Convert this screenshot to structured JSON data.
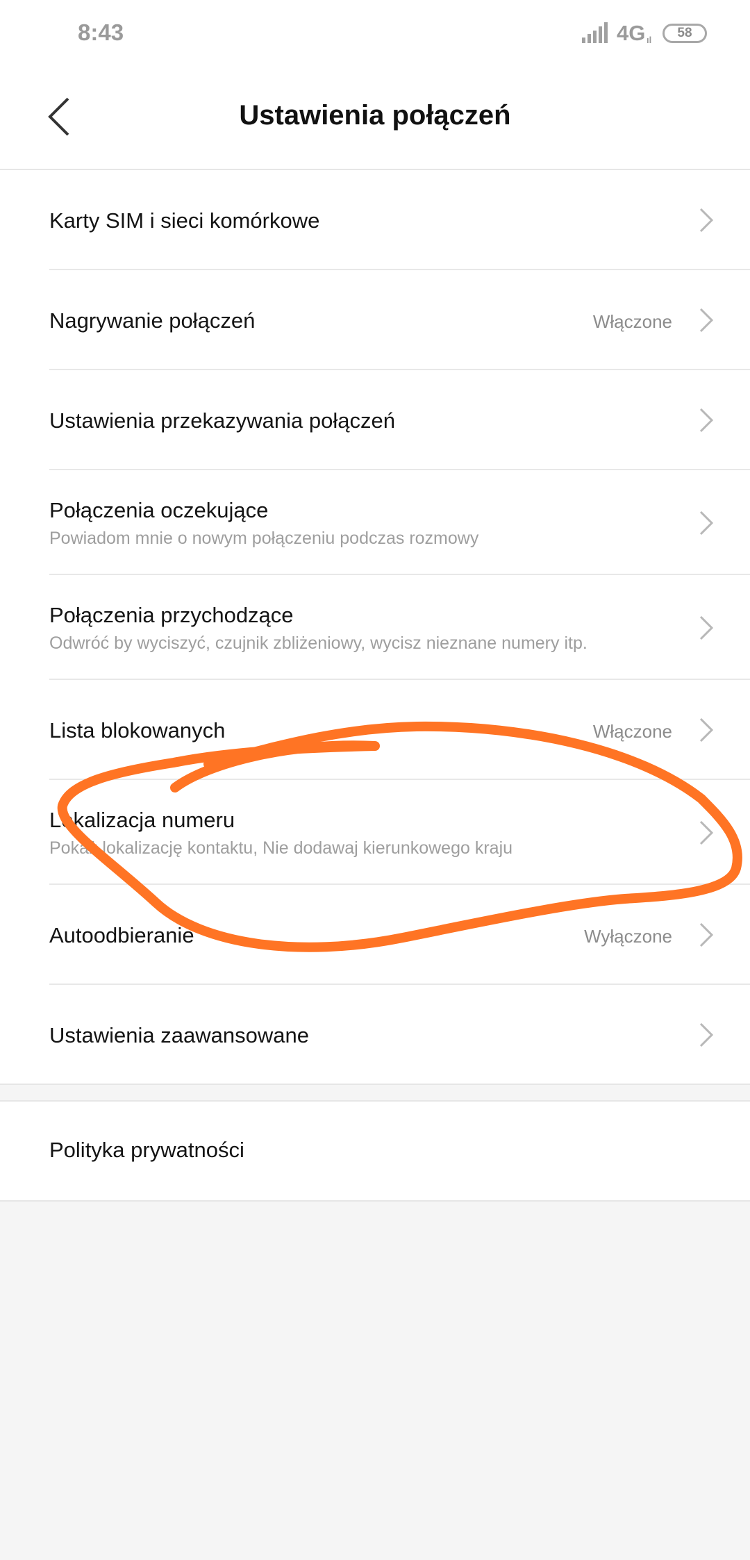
{
  "status_bar": {
    "time": "8:43",
    "network": "4G",
    "network_small": "ıl",
    "battery": "58"
  },
  "header": {
    "title": "Ustawienia połączeń",
    "back_icon": "chevron-left-icon"
  },
  "settings": [
    {
      "title": "Karty SIM i sieci komórkowe",
      "subtitle": "",
      "value": ""
    },
    {
      "title": "Nagrywanie połączeń",
      "subtitle": "",
      "value": "Włączone"
    },
    {
      "title": "Ustawienia przekazywania połączeń",
      "subtitle": "",
      "value": ""
    },
    {
      "title": "Połączenia oczekujące",
      "subtitle": "Powiadom mnie o nowym połączeniu podczas rozmowy",
      "value": ""
    },
    {
      "title": "Połączenia przychodzące",
      "subtitle": "Odwróć by wyciszyć, czujnik zbliżeniowy, wycisz nieznane numery itp.",
      "value": ""
    },
    {
      "title": "Lista blokowanych",
      "subtitle": "",
      "value": "Włączone"
    },
    {
      "title": "Lokalizacja numeru",
      "subtitle": "Pokaż lokalizację kontaktu, Nie dodawaj kierunkowego kraju",
      "value": ""
    },
    {
      "title": "Autoodbieranie",
      "subtitle": "",
      "value": "Wyłączone"
    },
    {
      "title": "Ustawienia zaawansowane",
      "subtitle": "",
      "value": ""
    }
  ],
  "privacy": {
    "title": "Polityka prywatności"
  },
  "colors": {
    "annotation": "#ff7424",
    "chevron": "#b8b8b8"
  }
}
